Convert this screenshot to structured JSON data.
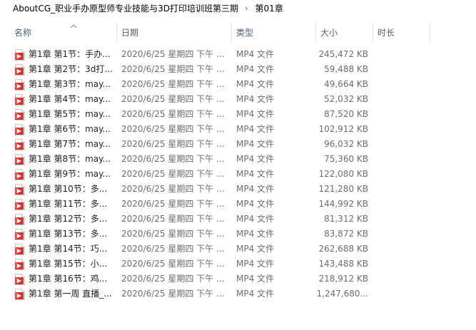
{
  "breadcrumb": {
    "items": [
      "AboutCG_职业手办原型师专业技能与3D打印培训班第三期",
      "第01章"
    ],
    "separator": "›"
  },
  "columns": {
    "name": "名称",
    "date": "日期",
    "type": "类型",
    "size": "大小",
    "duration": "时长"
  },
  "files": [
    {
      "name": "第1章 第1节：手办...",
      "date": "2020/6/25 星期四 下午 ...",
      "type": "MP4 文件",
      "size": "245,472 KB"
    },
    {
      "name": "第1章 第2节：3d打...",
      "date": "2020/6/25 星期四 下午 ...",
      "type": "MP4 文件",
      "size": "59,488 KB"
    },
    {
      "name": "第1章 第3节：may...",
      "date": "2020/6/25 星期四 下午 ...",
      "type": "MP4 文件",
      "size": "49,664 KB"
    },
    {
      "name": "第1章 第4节：may...",
      "date": "2020/6/25 星期四 下午 ...",
      "type": "MP4 文件",
      "size": "52,032 KB"
    },
    {
      "name": "第1章 第5节：may...",
      "date": "2020/6/25 星期四 下午 ...",
      "type": "MP4 文件",
      "size": "87,520 KB"
    },
    {
      "name": "第1章 第6节：may...",
      "date": "2020/6/25 星期四 下午 ...",
      "type": "MP4 文件",
      "size": "102,912 KB"
    },
    {
      "name": "第1章 第7节：may...",
      "date": "2020/6/25 星期四 下午 ...",
      "type": "MP4 文件",
      "size": "96,032 KB"
    },
    {
      "name": "第1章 第8节：may...",
      "date": "2020/6/25 星期四 下午 ...",
      "type": "MP4 文件",
      "size": "75,360 KB"
    },
    {
      "name": "第1章 第9节：may...",
      "date": "2020/6/25 星期四 下午 ...",
      "type": "MP4 文件",
      "size": "122,080 KB"
    },
    {
      "name": "第1章 第10节：多...",
      "date": "2020/6/25 星期四 下午 ...",
      "type": "MP4 文件",
      "size": "121,280 KB"
    },
    {
      "name": "第1章 第11节：多...",
      "date": "2020/6/25 星期四 下午 ...",
      "type": "MP4 文件",
      "size": "144,992 KB"
    },
    {
      "name": "第1章 第12节：多...",
      "date": "2020/6/25 星期四 下午 ...",
      "type": "MP4 文件",
      "size": "81,312 KB"
    },
    {
      "name": "第1章 第13节：多...",
      "date": "2020/6/25 星期四 下午 ...",
      "type": "MP4 文件",
      "size": "83,872 KB"
    },
    {
      "name": "第1章 第14节：巧...",
      "date": "2020/6/25 星期四 下午 ...",
      "type": "MP4 文件",
      "size": "262,688 KB"
    },
    {
      "name": "第1章 第15节：小...",
      "date": "2020/6/25 星期四 下午 ...",
      "type": "MP4 文件",
      "size": "143,488 KB"
    },
    {
      "name": "第1章 第16节：鸡...",
      "date": "2020/6/25 星期四 下午 ...",
      "type": "MP4 文件",
      "size": "218,912 KB"
    },
    {
      "name": "第1章 第一周 直播_...",
      "date": "2020/6/25 星期四 下午 ...",
      "type": "MP4 文件",
      "size": "1,247,680..."
    }
  ],
  "icons": {
    "file": "mp4-file-icon",
    "sort": "sort-up-arrow-icon"
  },
  "colors": {
    "icon_red": "#d9352f",
    "header_text": "#4c607a",
    "detail_text": "#6d6d6d"
  }
}
